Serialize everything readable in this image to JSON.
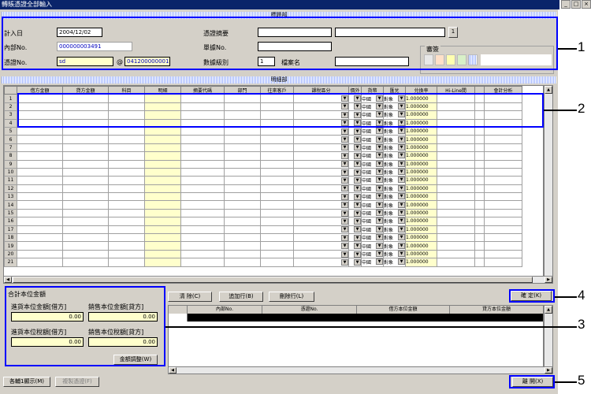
{
  "window": {
    "title": "轉賬憑證全部輸入"
  },
  "header_section": {
    "bar_label": "標題部",
    "entry_date_label": "計入日",
    "entry_date": "2004/12/02",
    "internal_no_label": "內部No.",
    "internal_no": "000000003491",
    "voucher_no_label": "憑證No.",
    "voucher_prefix": "sd",
    "voucher_at": "@",
    "voucher_no": "041200000001",
    "voucher_summary_label": "憑證摘要",
    "summary_value": "",
    "summary_extra": "",
    "lookup_btn": "1",
    "document_no_label": "單據No.",
    "document_no": "",
    "attachment_label": "數據級別",
    "attachment_count": "1",
    "file_name_label": "檔案名",
    "file_name": "",
    "approval_label": "審簽"
  },
  "detail_section": {
    "bar_label": "明細部",
    "columns": [
      "借方金額",
      "貸方金額",
      "科目",
      "明細",
      "摘要代碼",
      "部門",
      "往來客戶",
      "課稅區分",
      "價外",
      "貨幣",
      "匯兌",
      "兑換率",
      "Hi-Line間",
      "",
      "會計分析"
    ],
    "currency": "中國",
    "fx_type": "對象",
    "rate": "1.000000",
    "rows": [
      "1",
      "2",
      "3",
      "4",
      "5",
      "6",
      "7",
      "8",
      "9",
      "10",
      "11",
      "12",
      "13",
      "14",
      "15",
      "16",
      "17",
      "18",
      "19",
      "20",
      "21"
    ]
  },
  "totals": {
    "title": "合計本位金額",
    "debit_base_label": "進貨本位金額[借方]",
    "debit_base": "0.00",
    "credit_base_label": "銷售本位金額[貸方]",
    "credit_base": "0.00",
    "debit_tax_label": "進貨本位稅額[借方]",
    "debit_tax": "0.00",
    "credit_tax_label": "銷售本位稅額[貸方]",
    "credit_tax": "0.00",
    "adjust_btn": "金額調整(W)"
  },
  "actions": {
    "clear_btn": "清 除(C)",
    "add_row_btn": "追加行(B)",
    "delete_row_btn": "刪除行(L)",
    "confirm_btn": "確 定(K)",
    "close_btn": "離 開(X)",
    "show_all_btn": "各輔1顯示(M)",
    "copy_voucher_btn": "複製憑證(F)"
  },
  "lower_table": {
    "columns": [
      "內部No.",
      "憑證No.",
      "借方本位金額",
      "貸方本位金額"
    ]
  },
  "callouts": [
    "1",
    "2",
    "3",
    "4",
    "5"
  ],
  "colors": {
    "highlight": "#0000ff",
    "titlebar": "#0a246a",
    "yellow_field": "#ffffcc"
  }
}
